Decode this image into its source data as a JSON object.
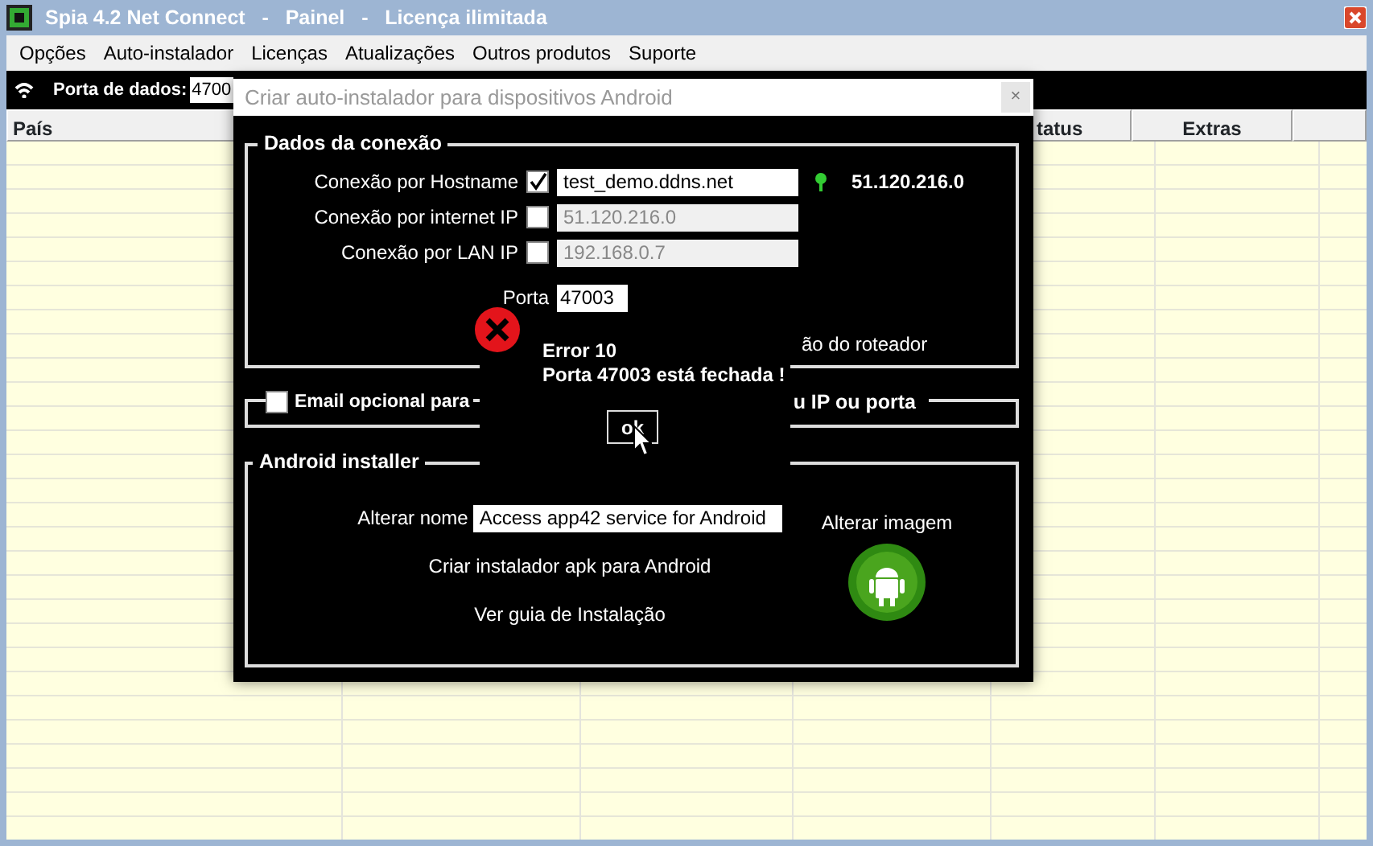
{
  "window": {
    "title": "Spia 4.2 Net Connect   -   Painel   -   Licença ilimitada"
  },
  "menu": [
    {
      "label": "Opções"
    },
    {
      "label": "Auto-instalador"
    },
    {
      "label": "Licenças"
    },
    {
      "label": "Atualizações"
    },
    {
      "label": "Outros produtos"
    },
    {
      "label": "Suporte"
    }
  ],
  "toolbar": {
    "label": "Porta de dados:",
    "value": "4700"
  },
  "table": {
    "columns": [
      {
        "label": "País"
      },
      {
        "label": "tatus"
      },
      {
        "label": "Extras"
      }
    ]
  },
  "dialog": {
    "title": "Criar auto-instalador para dispositivos Android",
    "close": "×",
    "connection": {
      "title": "Dados da conexão",
      "rows": [
        {
          "label": "Conexão por Hostname",
          "checked": true,
          "value": "test_demo.ddns.net",
          "disabled": false
        },
        {
          "label": "Conexão por internet IP",
          "checked": false,
          "value": "51.120.216.0",
          "disabled": true
        },
        {
          "label": "Conexão por LAN IP",
          "checked": false,
          "value": "192.168.0.7",
          "disabled": true
        }
      ],
      "status_ip": "51.120.216.0",
      "port": {
        "label": "Porta",
        "value": "47003"
      },
      "router_note": "ão do roteador"
    },
    "email": {
      "checked": false,
      "label_left": "Email opcional para",
      "label_right": "u IP ou porta"
    },
    "android": {
      "title": "Android installer",
      "name_label": "Alterar nome",
      "name_value": "Access app42 service for Android",
      "create_link": "Criar instalador apk para Android",
      "guide_link": "Ver guia de Instalação",
      "image_label": "Alterar imagem"
    }
  },
  "error": {
    "title": "Error 10",
    "message": "Porta 47003 está fechada !",
    "button": "ok"
  }
}
